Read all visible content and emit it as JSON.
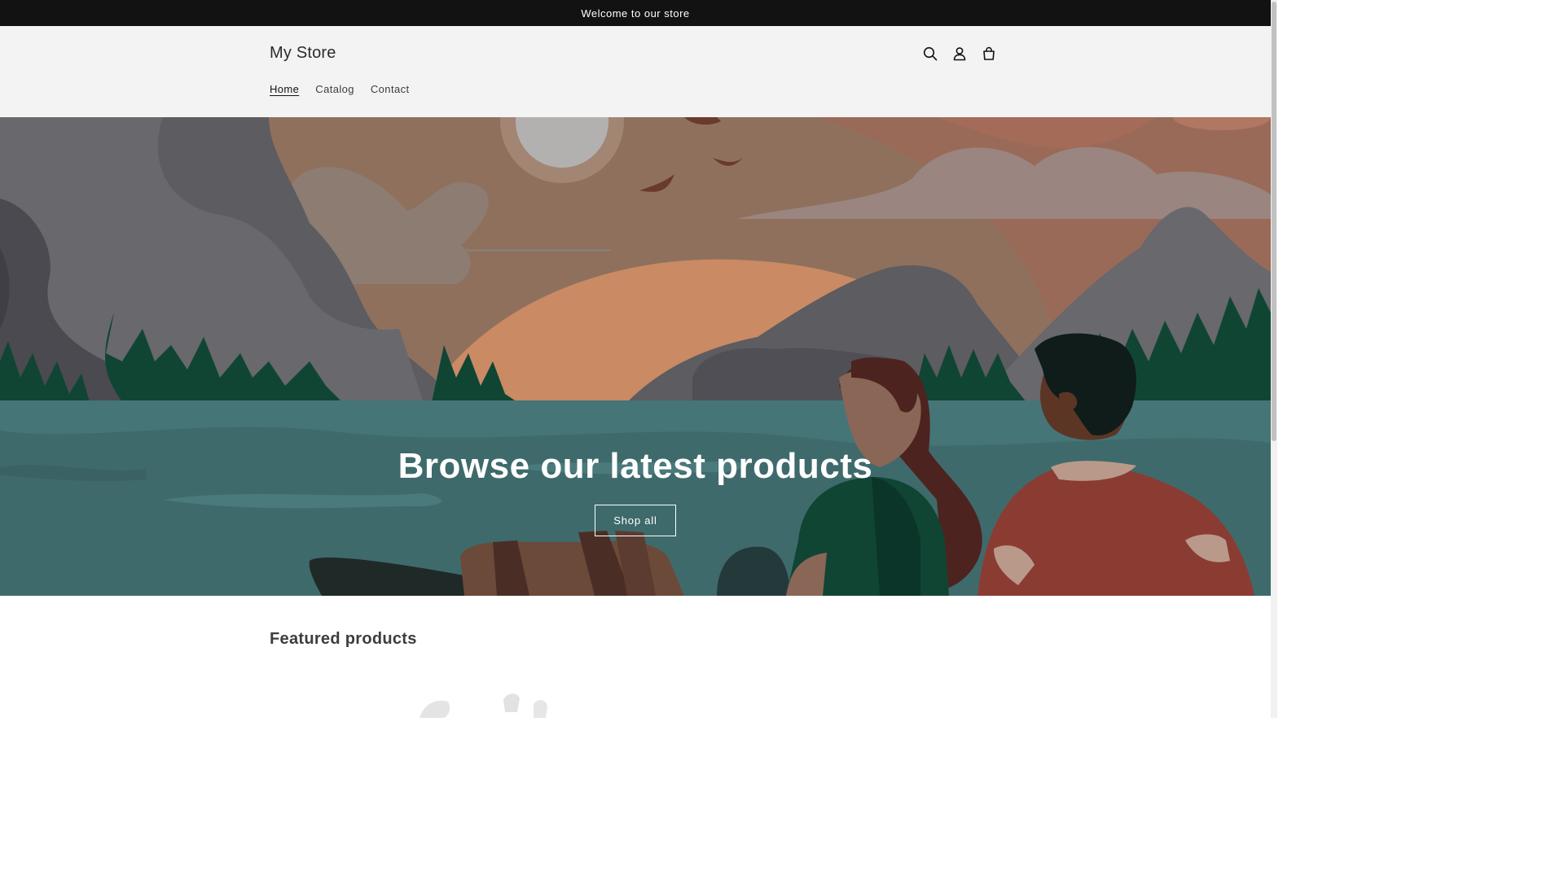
{
  "announcement": {
    "text": "Welcome to our store"
  },
  "header": {
    "logo": "My Store",
    "nav": [
      {
        "label": "Home",
        "active": true
      },
      {
        "label": "Catalog",
        "active": false
      },
      {
        "label": "Contact",
        "active": false
      }
    ],
    "icons": [
      "search-icon",
      "account-icon",
      "cart-icon"
    ]
  },
  "hero": {
    "title": "Browse our latest products",
    "button_label": "Shop all"
  },
  "featured": {
    "title": "Featured products"
  },
  "colors": {
    "announcement_bg": "#121212",
    "header_bg": "#f3f3f3",
    "sky": "#8f705d",
    "water": "#3f6a6c",
    "trees": "#104534"
  }
}
